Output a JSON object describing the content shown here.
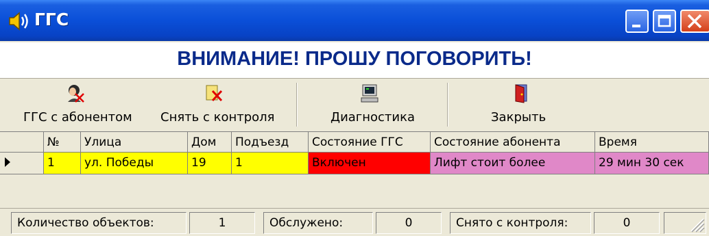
{
  "window": {
    "title": "ГГС"
  },
  "banner": {
    "text": "ВНИМАНИЕ! ПРОШУ ПОГОВОРИТЬ!"
  },
  "toolbar": {
    "buttons": [
      {
        "label": "ГГС с абонентом",
        "icon": "operator-headset-icon"
      },
      {
        "label": "Снять с контроля",
        "icon": "remove-document-icon"
      },
      {
        "label": "Диагностика",
        "icon": "computer-monitor-icon"
      },
      {
        "label": "Закрыть",
        "icon": "exit-door-icon"
      }
    ]
  },
  "table": {
    "columns": [
      "№",
      "Улица",
      "Дом",
      "Подъезд",
      "Состояние ГГС",
      "Состояние абонента",
      "Время"
    ],
    "rows": [
      {
        "num": "1",
        "street": "ул. Победы",
        "house": "19",
        "entrance": "1",
        "ggs_state": "Включен",
        "subscriber_state": "Лифт стоит более",
        "time": "29 мин 30 сек"
      }
    ]
  },
  "status": {
    "objects_label": "Количество объектов:",
    "objects_value": "1",
    "served_label": "Обслужено:",
    "served_value": "0",
    "removed_label": "Снято с контроля:",
    "removed_value": "0"
  },
  "colors": {
    "highlight_row": "#ffff00",
    "ggs_on": "#ff0000",
    "subscriber_alert": "#e088c8",
    "banner_text": "#0a2a8a"
  }
}
